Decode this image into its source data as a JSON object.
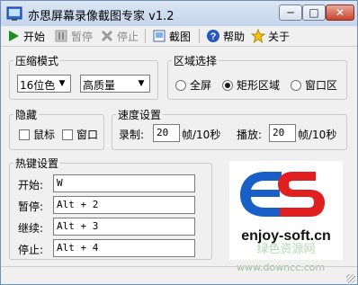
{
  "window": {
    "title": "亦思屏幕录像截图专家 v1.2"
  },
  "toolbar": {
    "start": "开始",
    "pause": "暂停",
    "stop": "停止",
    "screenshot": "截图",
    "help": "帮助",
    "about": "关于"
  },
  "compression": {
    "legend": "压缩模式",
    "color_depth": "16位色",
    "quality": "高质量"
  },
  "region": {
    "legend": "区域选择",
    "options": [
      "全屏",
      "矩形区域",
      "窗口区"
    ],
    "selected": "矩形区域"
  },
  "hide": {
    "legend": "隐藏",
    "mouse": "鼠标",
    "window": "窗口"
  },
  "speed": {
    "legend": "速度设置",
    "record_label": "录制:",
    "record_value": "20",
    "record_unit": "帧/10秒",
    "play_label": "播放:",
    "play_value": "20",
    "play_unit": "帧/10秒"
  },
  "hotkeys": {
    "legend": "热键设置",
    "start_label": "开始:",
    "start_value": "W",
    "pause_label": "暂停:",
    "pause_value": "Alt + 2",
    "resume_label": "继续:",
    "resume_value": "Alt + 3",
    "stop_label": "停止:",
    "stop_value": "Alt + 4"
  },
  "logo": {
    "text": "enjoy-soft.cn",
    "watermark_top": "绿色资源网",
    "watermark_bottom": "www.downcc.com"
  },
  "colors": {
    "logo_blue": "#1a5fc8",
    "logo_red": "#e02020",
    "title_bar": "#c4d5ec"
  }
}
